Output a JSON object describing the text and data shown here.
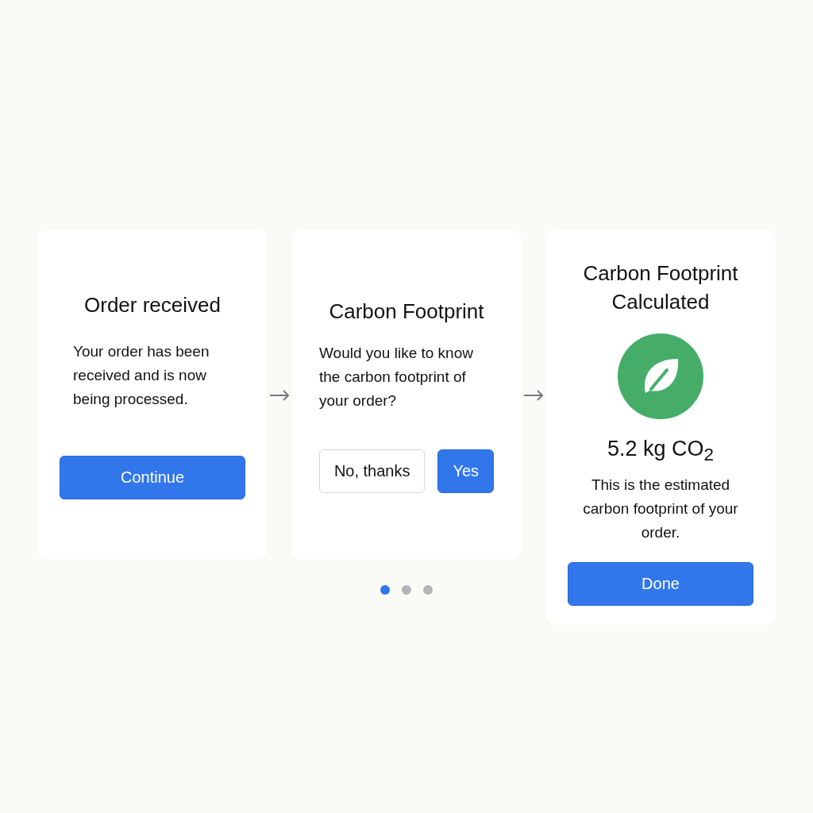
{
  "steps": [
    {
      "kind": "info",
      "title": "Order received",
      "text": "Your order has been received and is now being processed.",
      "buttons": [
        {
          "label": "Continue",
          "primary": true
        }
      ]
    },
    {
      "kind": "question",
      "title": "Carbon Footprint",
      "text": "Would you like to know the carbon footprint of your order?",
      "buttons": [
        {
          "label": "No, thanks",
          "primary": false
        },
        {
          "label": "Yes",
          "primary": true
        }
      ]
    },
    {
      "kind": "result",
      "title": "Carbon Footprint Calculated",
      "value": "5.2 kg CO$_{2}$",
      "text": "This is the estimated carbon footprint of your order.",
      "buttons": [
        {
          "label": "Done",
          "primary": true
        }
      ]
    }
  ],
  "dots": [
    {
      "selected": true
    },
    {
      "selected": false
    },
    {
      "selected": false
    }
  ]
}
